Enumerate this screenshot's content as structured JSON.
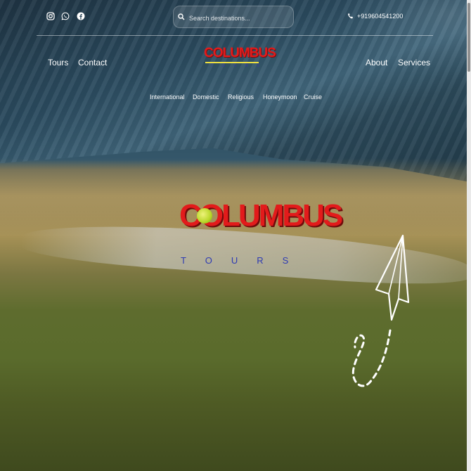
{
  "social": [
    {
      "name": "instagram-icon"
    },
    {
      "name": "whatsapp-icon"
    },
    {
      "name": "facebook-icon"
    }
  ],
  "search": {
    "placeholder": "Search destinations..."
  },
  "contact": {
    "phone": "+919604541200"
  },
  "nav": {
    "left": [
      "Tours",
      "Contact"
    ],
    "right": [
      "About",
      "Services"
    ]
  },
  "subnav": [
    "International",
    "Domestic",
    "Religious",
    "Honeymoon",
    "Cruise"
  ],
  "logo": {
    "brand": "COLUMBUS",
    "tagline": "TOURS"
  },
  "colors": {
    "brand_red": "#e21b1b",
    "brand_blue": "#2e3bb4",
    "accent_yellow": "#f0e040"
  }
}
